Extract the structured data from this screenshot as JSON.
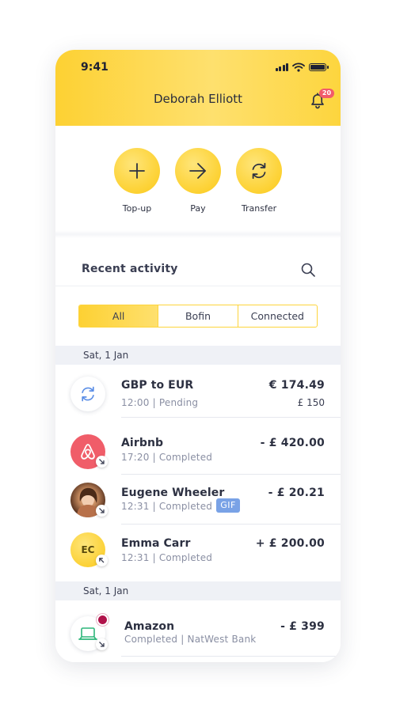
{
  "status_bar": {
    "time": "9:41"
  },
  "header": {
    "user_name": "Deborah Elliott",
    "notification_count": "20"
  },
  "actions": [
    {
      "label": "Top-up",
      "icon": "plus-icon"
    },
    {
      "label": "Pay",
      "icon": "arrow-right-icon"
    },
    {
      "label": "Transfer",
      "icon": "refresh-icon"
    }
  ],
  "recent": {
    "title": "Recent activity",
    "filters": [
      {
        "label": "All",
        "active": true
      },
      {
        "label": "Bofin",
        "active": false
      },
      {
        "label": "Connected",
        "active": false
      }
    ],
    "groups": [
      {
        "date": "Sat, 1 Jan",
        "items": [
          {
            "title": "GBP to EUR",
            "subtitle": "12:00 | Pending",
            "amount": "€ 174.49",
            "amount_secondary": "£ 150",
            "icon": "exchange-icon"
          },
          {
            "title": "Airbnb",
            "subtitle": "17:20 | Completed",
            "amount": "- £ 420.00",
            "icon": "airbnb-logo-icon",
            "direction": "outgoing"
          },
          {
            "title": "Eugene Wheeler",
            "subtitle": "12:31 | Completed",
            "amount": "- £ 20.21",
            "tag": "GIF",
            "direction": "outgoing"
          },
          {
            "title": "Emma Carr",
            "subtitle": "12:31 | Completed",
            "amount": "+ £ 200.00",
            "initials": "EC",
            "direction": "incoming"
          }
        ]
      },
      {
        "date": "Sat, 1 Jan",
        "items": [
          {
            "title": "Amazon",
            "subtitle": "Completed | NatWest Bank",
            "amount": "- £ 399",
            "icon": "laptop-icon",
            "direction": "outgoing"
          }
        ]
      }
    ]
  },
  "colors": {
    "accent_yellow": "#fdd43c",
    "airbnb_red": "#f05d69",
    "badge_red": "#f25b6a",
    "gif_blue": "#79a2e6",
    "exchange_blue": "#5b8ee6",
    "laptop_green": "#2db67a"
  }
}
